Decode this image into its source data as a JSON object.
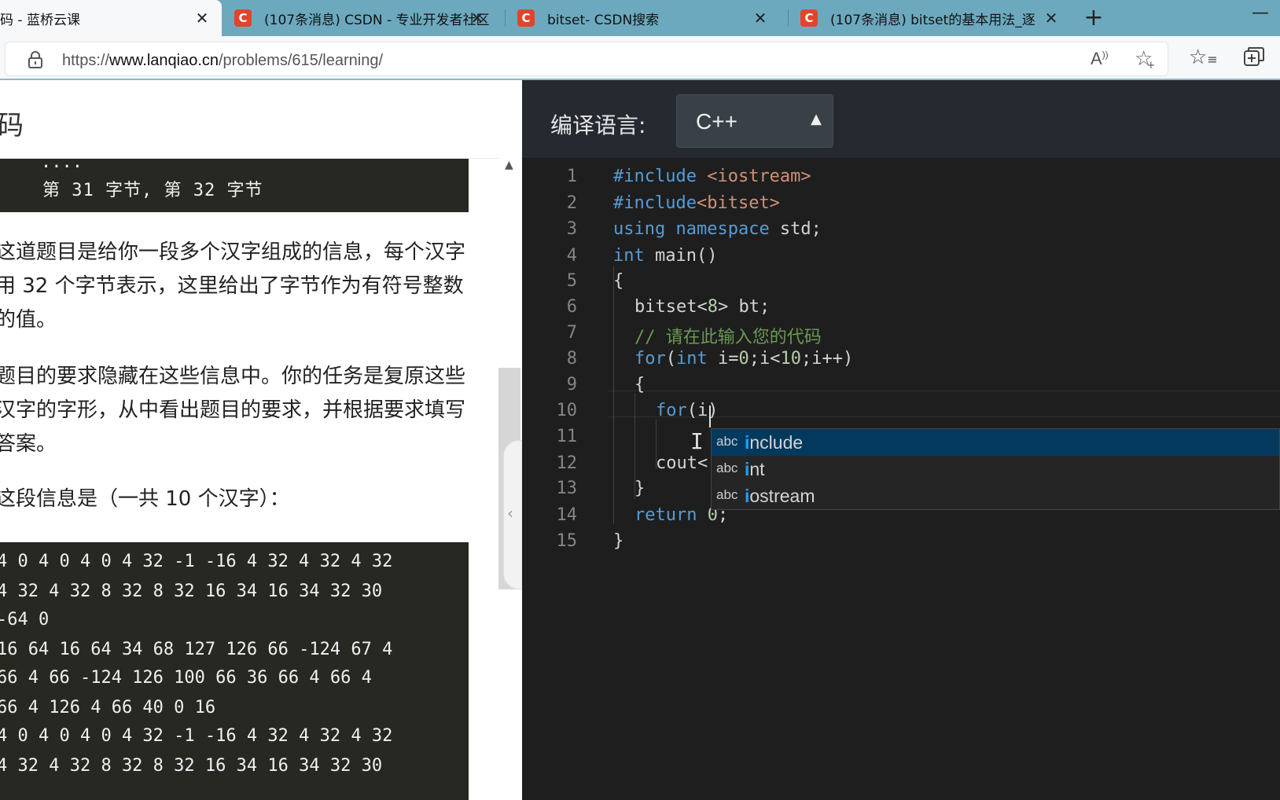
{
  "browser": {
    "tabs": [
      {
        "title": "码 - 蓝桥云课",
        "favicon": "",
        "active": true
      },
      {
        "title": "(107条消息) CSDN - 专业开发者社区",
        "favicon": "C",
        "active": false
      },
      {
        "title": "bitset- CSDN搜索",
        "favicon": "C",
        "active": false
      },
      {
        "title": "(107条消息) bitset的基本用法_逐",
        "favicon": "C",
        "active": false
      }
    ],
    "new_tab_glyph": "+",
    "minimize_glyph": "—",
    "url_protocol": "https://",
    "url_host": "www.lanqiao.cn",
    "url_path": "/problems/615/learning/",
    "read_aloud_glyph": "Aͅ",
    "favorite_add_glyph": "☆",
    "favorites_glyph": "☆"
  },
  "problem": {
    "heading": "码",
    "code_top_dots": "....",
    "code_top_line": "第 31 字节, 第 32 字节",
    "paragraph1": "这道题目是给你一段多个汉字组成的信息，每个汉字用 32 个字节表示，这里给出了字节作为有符号整数的值。",
    "paragraph2": "题目的要求隐藏在这些信息中。你的任务是复原这些汉字的字形，从中看出题目的要求，并根据要求填写答案。",
    "paragraph3": "这段信息是（一共 10 个汉字）：",
    "data_lines": [
      "4 0 4 0 4 0 4 32 -1 -16 4 32 4 32 4 32",
      "4 32 4 32 8 32 8 32 16 34 16 34 32 30",
      "-64 0",
      "16 64 16 64 34 68 127 126 66 -124 67 4",
      "66 4 66 -124 126 100 66 36 66 4 66 4",
      "66 4 126 4 66 40 0 16",
      "4 0 4 0 4 0 4 32 -1 -16 4 32 4 32 4 32",
      "4 32 4 32 8 32 8 32 16 34 16 34 32 30"
    ],
    "scroll_up_glyph": "▲",
    "collapse_glyph": "‹"
  },
  "editor": {
    "language_label": "编译语言:",
    "language_value": "C++",
    "caret_glyph": "▲",
    "line_numbers": [
      "1",
      "2",
      "3",
      "4",
      "5",
      "6",
      "7",
      "8",
      "9",
      "10",
      "11",
      "12",
      "13",
      "14",
      "15"
    ],
    "code": {
      "l1_kw": "#include",
      "l1_str": " <iostream>",
      "l2_kw": "#include",
      "l2_str": "<bitset>",
      "l3_kw1": "using",
      "l3_kw2": " namespace",
      "l3_rest": " std;",
      "l4_kw": "int",
      "l4_rest": " main()",
      "l5": "{",
      "l6": "bitset<8> bt;",
      "l6_a": "bitset<",
      "l6_num": "8",
      "l6_b": "> bt;",
      "l7": "// 请在此输入您的代码",
      "l8_for": "for",
      "l8_a": "(",
      "l8_int": "int",
      "l8_b": " i=",
      "l8_n0": "0",
      "l8_c": ";i<",
      "l8_n10": "10",
      "l8_d": ";i++)",
      "l9": "{",
      "l10_for": "for",
      "l10_rest": "(i)",
      "l12": "cout<",
      "l13": "}",
      "l14_kw": "return",
      "l14_num": " 0",
      "l14_rest": ";",
      "l15": "}"
    },
    "ibeam_glyph": "I",
    "suggestions": [
      {
        "kind": "abc",
        "match": "i",
        "rest": "nclude",
        "selected": true
      },
      {
        "kind": "abc",
        "match": "i",
        "rest": "nt",
        "selected": false
      },
      {
        "kind": "abc",
        "match": "i",
        "rest": "ostream",
        "selected": false
      }
    ]
  }
}
